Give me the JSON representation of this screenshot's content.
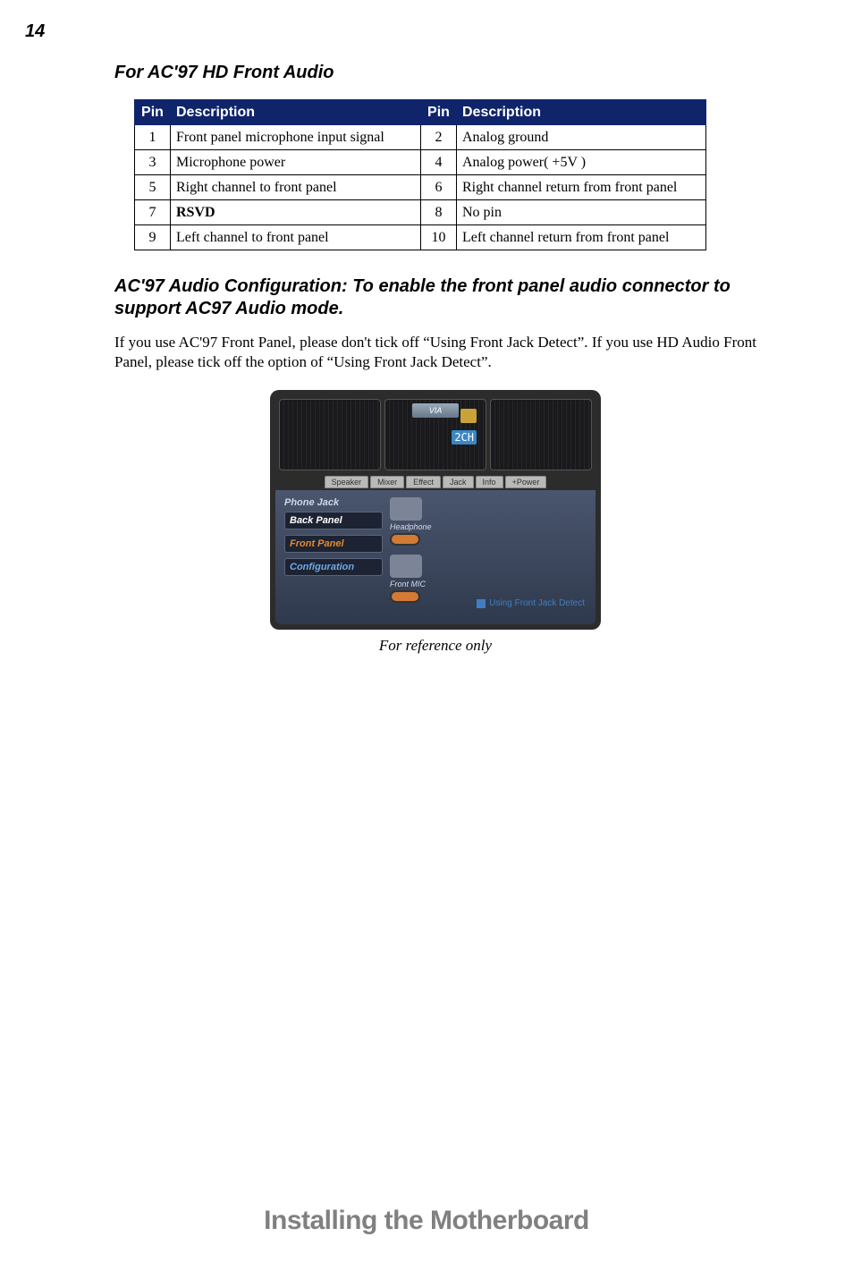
{
  "page_number": "14",
  "section_heading": "For AC'97 HD Front Audio",
  "pin_table": {
    "headers": {
      "pin": "Pin",
      "desc": "Description",
      "pin2": "Pin",
      "desc2": "Description"
    },
    "rows": [
      {
        "p1": "1",
        "d1": "Front panel microphone input signal",
        "p2": "2",
        "d2": "Analog ground"
      },
      {
        "p1": "3",
        "d1": "Microphone power",
        "p2": "4",
        "d2": "Analog power( +5V )"
      },
      {
        "p1": "5",
        "d1": "Right channel to front panel",
        "p2": "6",
        "d2": "Right channel return from front panel"
      },
      {
        "p1": "7",
        "d1": "RSVD",
        "p2": "8",
        "d2": "No pin"
      },
      {
        "p1": "9",
        "d1": "Left channel to front panel",
        "p2": "10",
        "d2": "Left channel return from front panel"
      }
    ]
  },
  "sub_heading": "AC'97 Audio Configuration: To enable the front panel audio connector to support AC97 Audio mode.",
  "body_text": "If you use AC'97 Front Panel, please don't tick off “Using Front Jack Detect”. If you use HD Audio Front Panel, please tick off the option of “Using Front Jack Detect”.",
  "figure": {
    "via_logo": "VIA",
    "channel_badge": "2CH",
    "tabs": [
      "Speaker",
      "Mixer",
      "Effect",
      "Jack",
      "Info",
      "+Power"
    ],
    "phone_jack_label": "Phone Jack",
    "back_panel_btn": "Back Panel",
    "front_panel_btn": "Front Panel",
    "configuration_btn": "Configuration",
    "headphone_label": "Headphone",
    "front_mic_label": "Front MIC",
    "option_label": "Using Front Jack Detect"
  },
  "caption": "For reference only",
  "footer_title": "Installing the Motherboard"
}
